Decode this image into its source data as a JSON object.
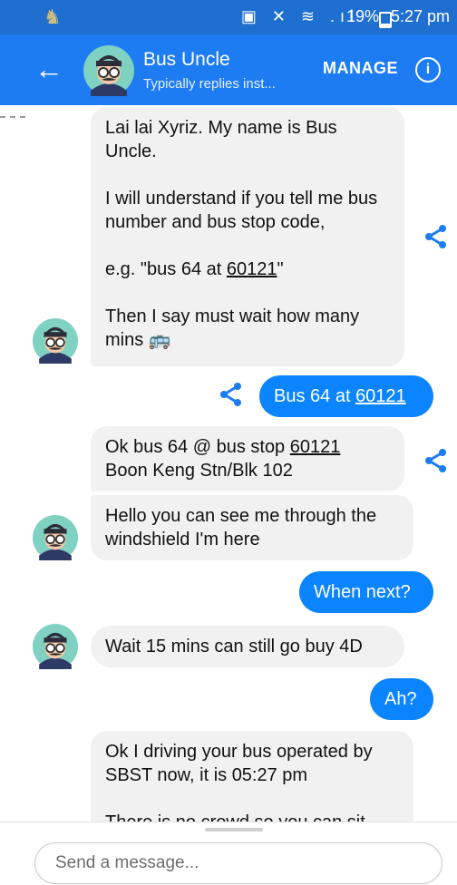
{
  "status_bar": {
    "icons": "▣ ✕ ≋ .ıl",
    "battery": "19%",
    "time": "5:27 pm",
    "bar_color": "#1f6fd1"
  },
  "header": {
    "name": "Bus Uncle",
    "subtitle": "Typically replies inst...",
    "manage": "MANAGE",
    "info": "i",
    "back_icon": "←",
    "bg": "#1d7cf2"
  },
  "messages": {
    "m1_p1": "Lai lai Xyriz. My name is Bus Uncle.",
    "m1_p2": "I will understand if you tell me bus number and bus stop code,",
    "m1_p3a": "e.g. \"bus 64 at ",
    "m1_p3b": "60121",
    "m1_p3c": "\"",
    "m1_p4": "Then I say must wait how many mins 🚌",
    "out1_a": "Bus 64 at ",
    "out1_b": "60121",
    "m2_line1a": "Ok bus 64 @ bus stop ",
    "m2_line1b": "60121",
    "m2_line2": "Boon Keng Stn/Blk 102",
    "m3": "Hello you can see me through the windshield I'm here",
    "out2": "When next?",
    "m4": "Wait 15 mins can still go buy 4D",
    "out3": "Ah?",
    "m5_p1": "Ok I driving your bus operated by SBST now, it is 05:27 pm",
    "m5_p2": "There is no crowd so you can sit"
  },
  "composer": {
    "placeholder": "Send a message..."
  }
}
